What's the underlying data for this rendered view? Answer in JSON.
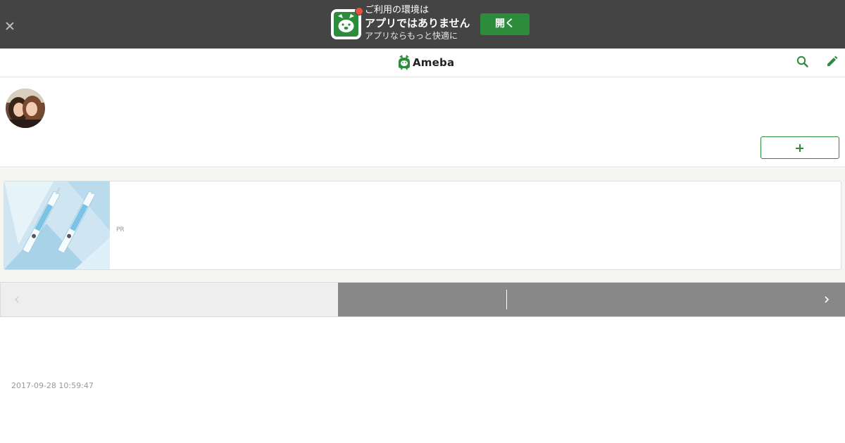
{
  "app_banner": {
    "line1": "ご利用の環境は",
    "line2": "アプリではありません",
    "line3": "アプリならもっと快適に",
    "open_label": "開く",
    "close_icon": "close-icon",
    "colors": {
      "background": "#444444",
      "button": "#2d8c3c",
      "notification": "#e9533d"
    }
  },
  "header": {
    "logo_text": "Ameba",
    "icons": [
      "search-icon",
      "pencil-icon"
    ],
    "accent": "#2d8c3c"
  },
  "profile": {
    "blog_title": "",
    "follow_icon": "plus-icon"
  },
  "ad": {
    "pr_label": "PR"
  },
  "pager": {
    "prev_icon": "chevron-left-icon",
    "next_icon": "chevron-right-icon"
  },
  "entry": {
    "timestamp": "2017-09-28 10:59:47"
  }
}
